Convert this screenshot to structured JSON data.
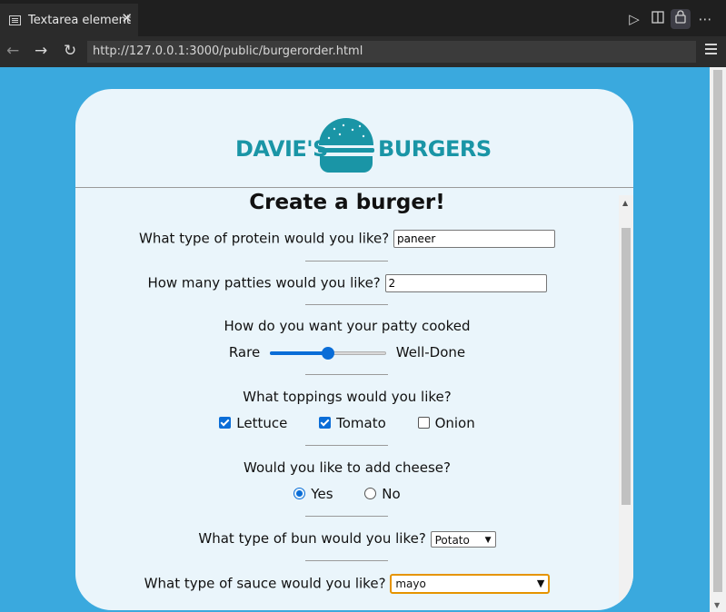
{
  "browser": {
    "tab_title": "Textarea element",
    "tab_close": "✕",
    "url": "http://127.0.0.1:3000/public/burgerorder.html"
  },
  "logo": {
    "left": "DAVIE'S",
    "right": "BURGERS"
  },
  "form": {
    "heading": "Create a burger!",
    "protein": {
      "label": "What type of protein would you like?",
      "value": "paneer"
    },
    "patties": {
      "label": "How many patties would you like?",
      "value": "2"
    },
    "cook": {
      "label": "How do you want your patty cooked",
      "min_label": "Rare",
      "max_label": "Well-Done",
      "level": 0.5
    },
    "toppings": {
      "label": "What toppings would you like?",
      "items": [
        {
          "label": "Lettuce",
          "checked": true
        },
        {
          "label": "Tomato",
          "checked": true
        },
        {
          "label": "Onion",
          "checked": false
        }
      ]
    },
    "cheese": {
      "label": "Would you like to add cheese?",
      "options": [
        {
          "label": "Yes",
          "selected": true
        },
        {
          "label": "No",
          "selected": false
        }
      ]
    },
    "bun": {
      "label": "What type of bun would you like?",
      "selected": "Potato"
    },
    "sauce": {
      "label": "What type of sauce would you like?",
      "selected": "mayo"
    }
  },
  "colors": {
    "page_bg": "#3aa9de",
    "card_bg": "#eaf5fb",
    "brand": "#1a95a6",
    "accent": "#0a6dd7",
    "focus": "#e59400"
  }
}
